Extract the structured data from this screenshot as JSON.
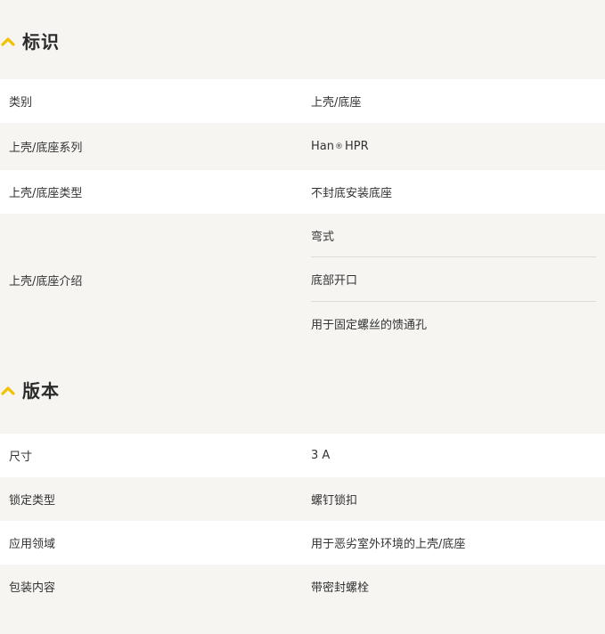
{
  "sections": [
    {
      "title": "标识",
      "rows": [
        {
          "label": "类别",
          "value": "上壳/底座"
        },
        {
          "label": "上壳/底座系列",
          "value_prefix": "Han",
          "value_mark": "®",
          "value_suffix": " HPR"
        },
        {
          "label": "上壳/底座类型",
          "value": "不封底安装底座"
        },
        {
          "label": "上壳/底座介绍",
          "values": [
            "弯式",
            "底部开口",
            "用于固定螺丝的馈通孔"
          ]
        }
      ]
    },
    {
      "title": "版本",
      "rows": [
        {
          "label": "尺寸",
          "value": "3 A"
        },
        {
          "label": "锁定类型",
          "value": "螺钉锁扣"
        },
        {
          "label": "应用领域",
          "value": "用于恶劣室外环境的上壳/底座"
        },
        {
          "label": "包装内容",
          "value": "带密封螺栓"
        }
      ]
    }
  ],
  "accent_color": "#f2c200"
}
